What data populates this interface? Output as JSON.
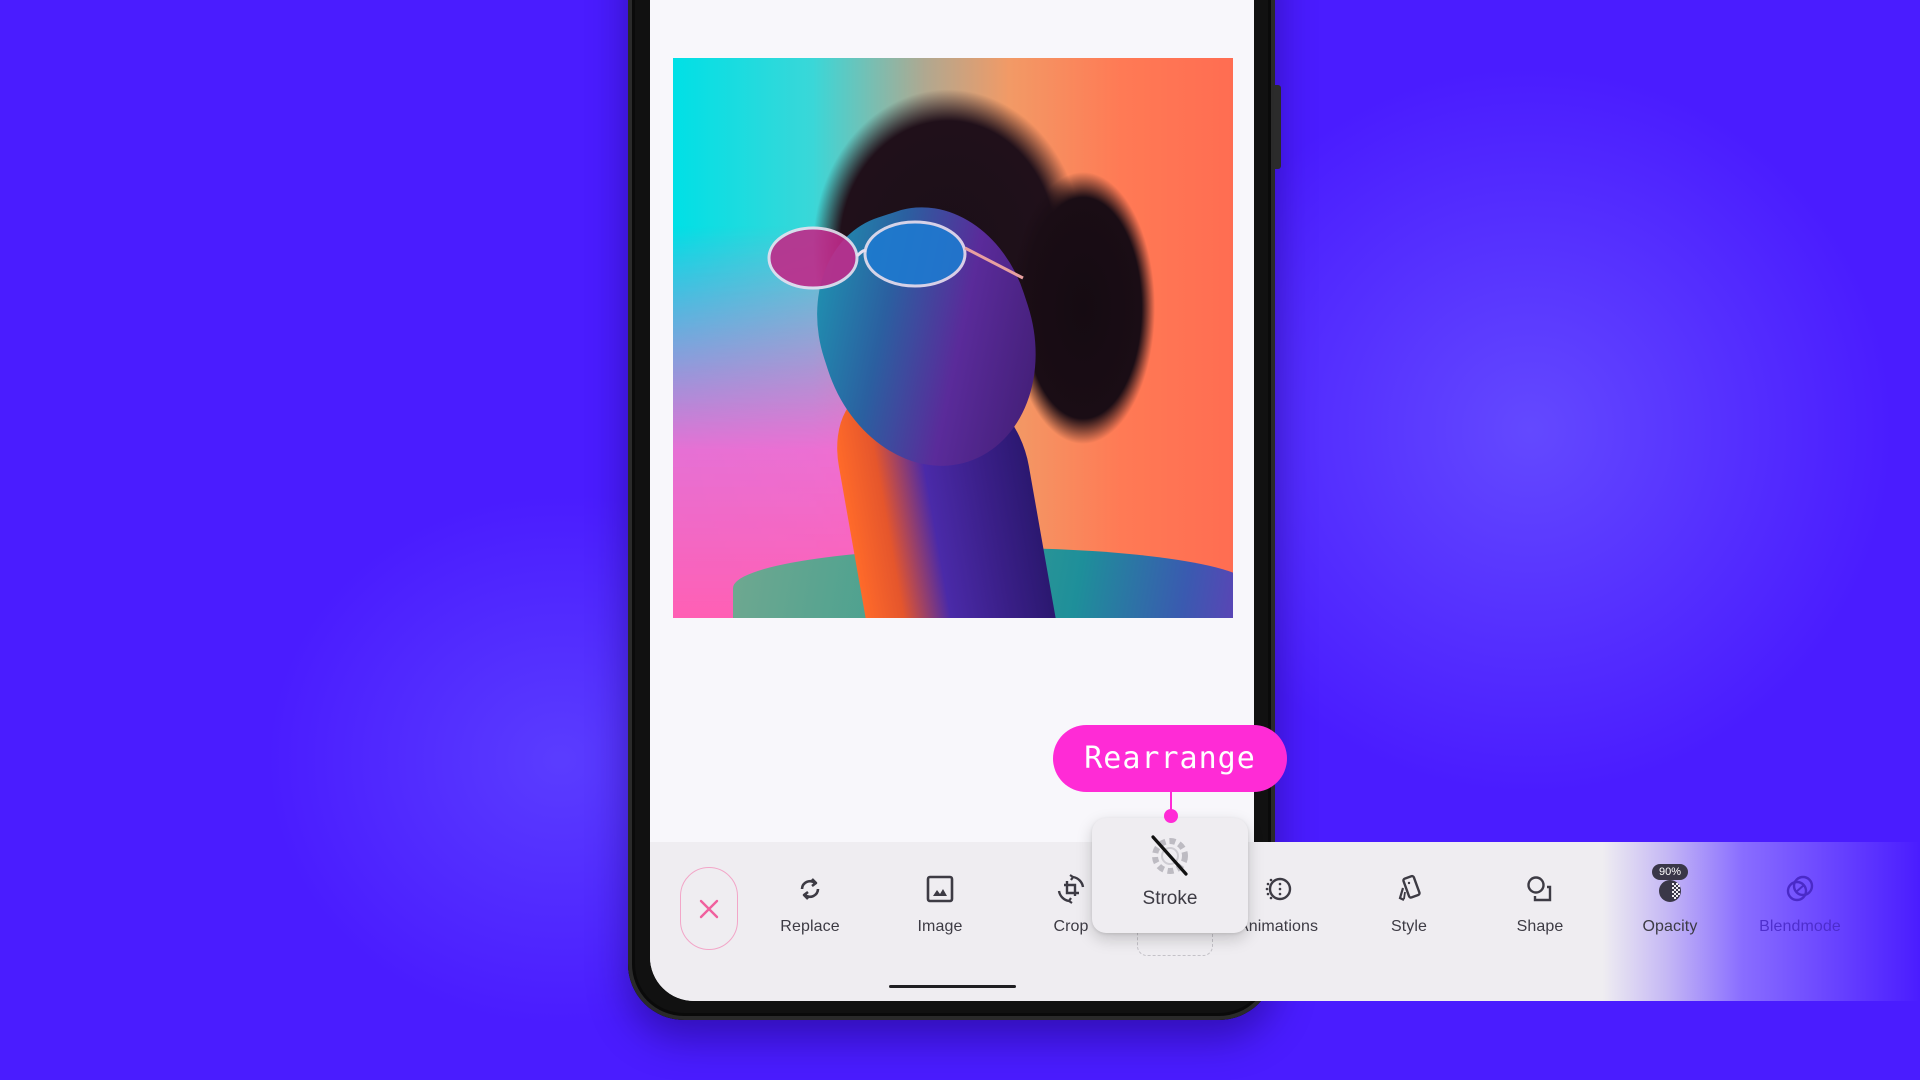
{
  "colors": {
    "background": "#4a1cff",
    "accent_pink": "#ff2bd6",
    "toolbar_bg": "#efedf1",
    "close_icon": "#f0609e",
    "icon_dark": "#3d3b44",
    "blendmode_tint": "#4a2ac8"
  },
  "callout": {
    "label": "Rearrange"
  },
  "toolbar": {
    "close_button": {
      "icon": "close-icon"
    },
    "items": [
      {
        "label": "Replace",
        "icon": "replace-icon"
      },
      {
        "label": "Image",
        "icon": "image-icon"
      },
      {
        "label": "Crop",
        "icon": "crop-rotate-icon"
      },
      {
        "label": "Animations",
        "icon": "animations-icon"
      },
      {
        "label": "Style",
        "icon": "style-icon"
      },
      {
        "label": "Shape",
        "icon": "shape-icon"
      },
      {
        "label": "Opacity",
        "icon": "opacity-icon",
        "badge": "90%"
      },
      {
        "label": "Blendmode",
        "icon": "blendmode-icon"
      }
    ],
    "dragging_item": {
      "label": "Stroke",
      "icon": "stroke-off-icon"
    }
  },
  "canvas": {
    "photo": {
      "description": "portrait-photo"
    }
  }
}
